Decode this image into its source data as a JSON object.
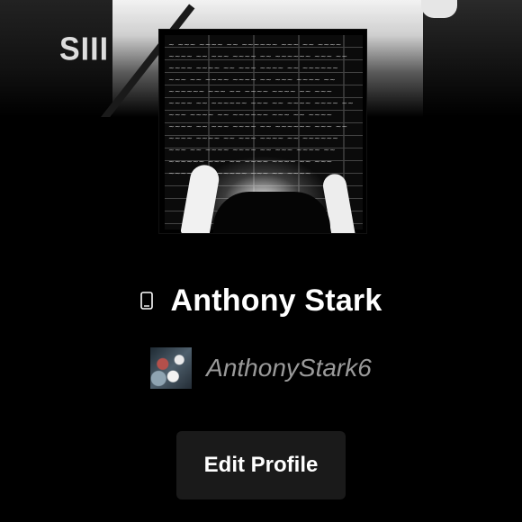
{
  "banner": {
    "sleeve_text": "SIII"
  },
  "profile": {
    "display_name": "Anthony Stark",
    "username": "AnthonyStark6",
    "device_icon": "phone-icon"
  },
  "actions": {
    "edit_label": "Edit Profile"
  }
}
